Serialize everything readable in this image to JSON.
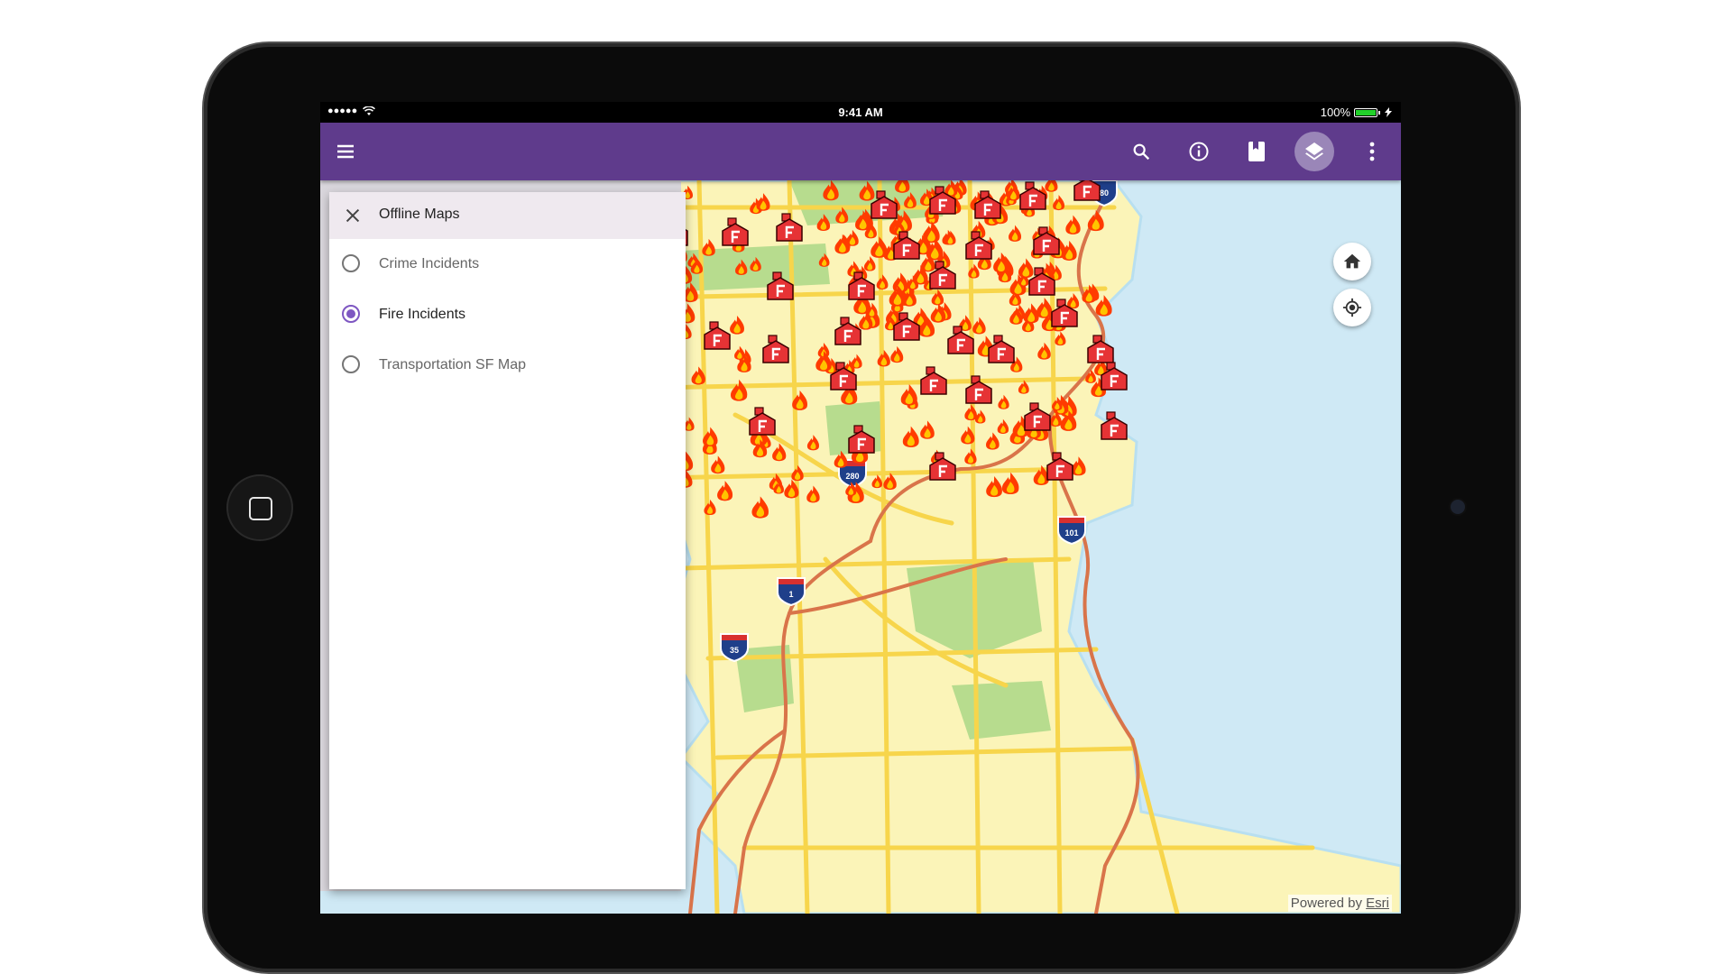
{
  "status_bar": {
    "time": "9:41 AM",
    "battery": "100%",
    "signal": "●●●●●"
  },
  "app_bar": {
    "menu_icon": "hamburger-menu-icon",
    "actions": [
      "search-icon",
      "info-icon",
      "bookmark-icon",
      "layers-icon",
      "more-vert-icon"
    ],
    "active_action": "layers-icon",
    "color": "#5f3b8c"
  },
  "drawer": {
    "title": "Offline Maps",
    "items": [
      {
        "label": "Crime Incidents",
        "selected": false
      },
      {
        "label": "Fire Incidents",
        "selected": true
      },
      {
        "label": "Transportation SF Map",
        "selected": false
      }
    ],
    "accent": "#7e57c2"
  },
  "map": {
    "highway_shields": [
      "80",
      "280",
      "101",
      "1",
      "35"
    ],
    "controls": [
      "home-icon",
      "my-location-icon"
    ],
    "attribution_prefix": "Powered by",
    "attribution_link": "Esri",
    "colors": {
      "water": "#cfe9f5",
      "land": "#fbf4b8",
      "park": "#b7dc8e",
      "road": "#f7d54b",
      "highway": "#d9744a",
      "fire": "#ff3b00"
    }
  }
}
